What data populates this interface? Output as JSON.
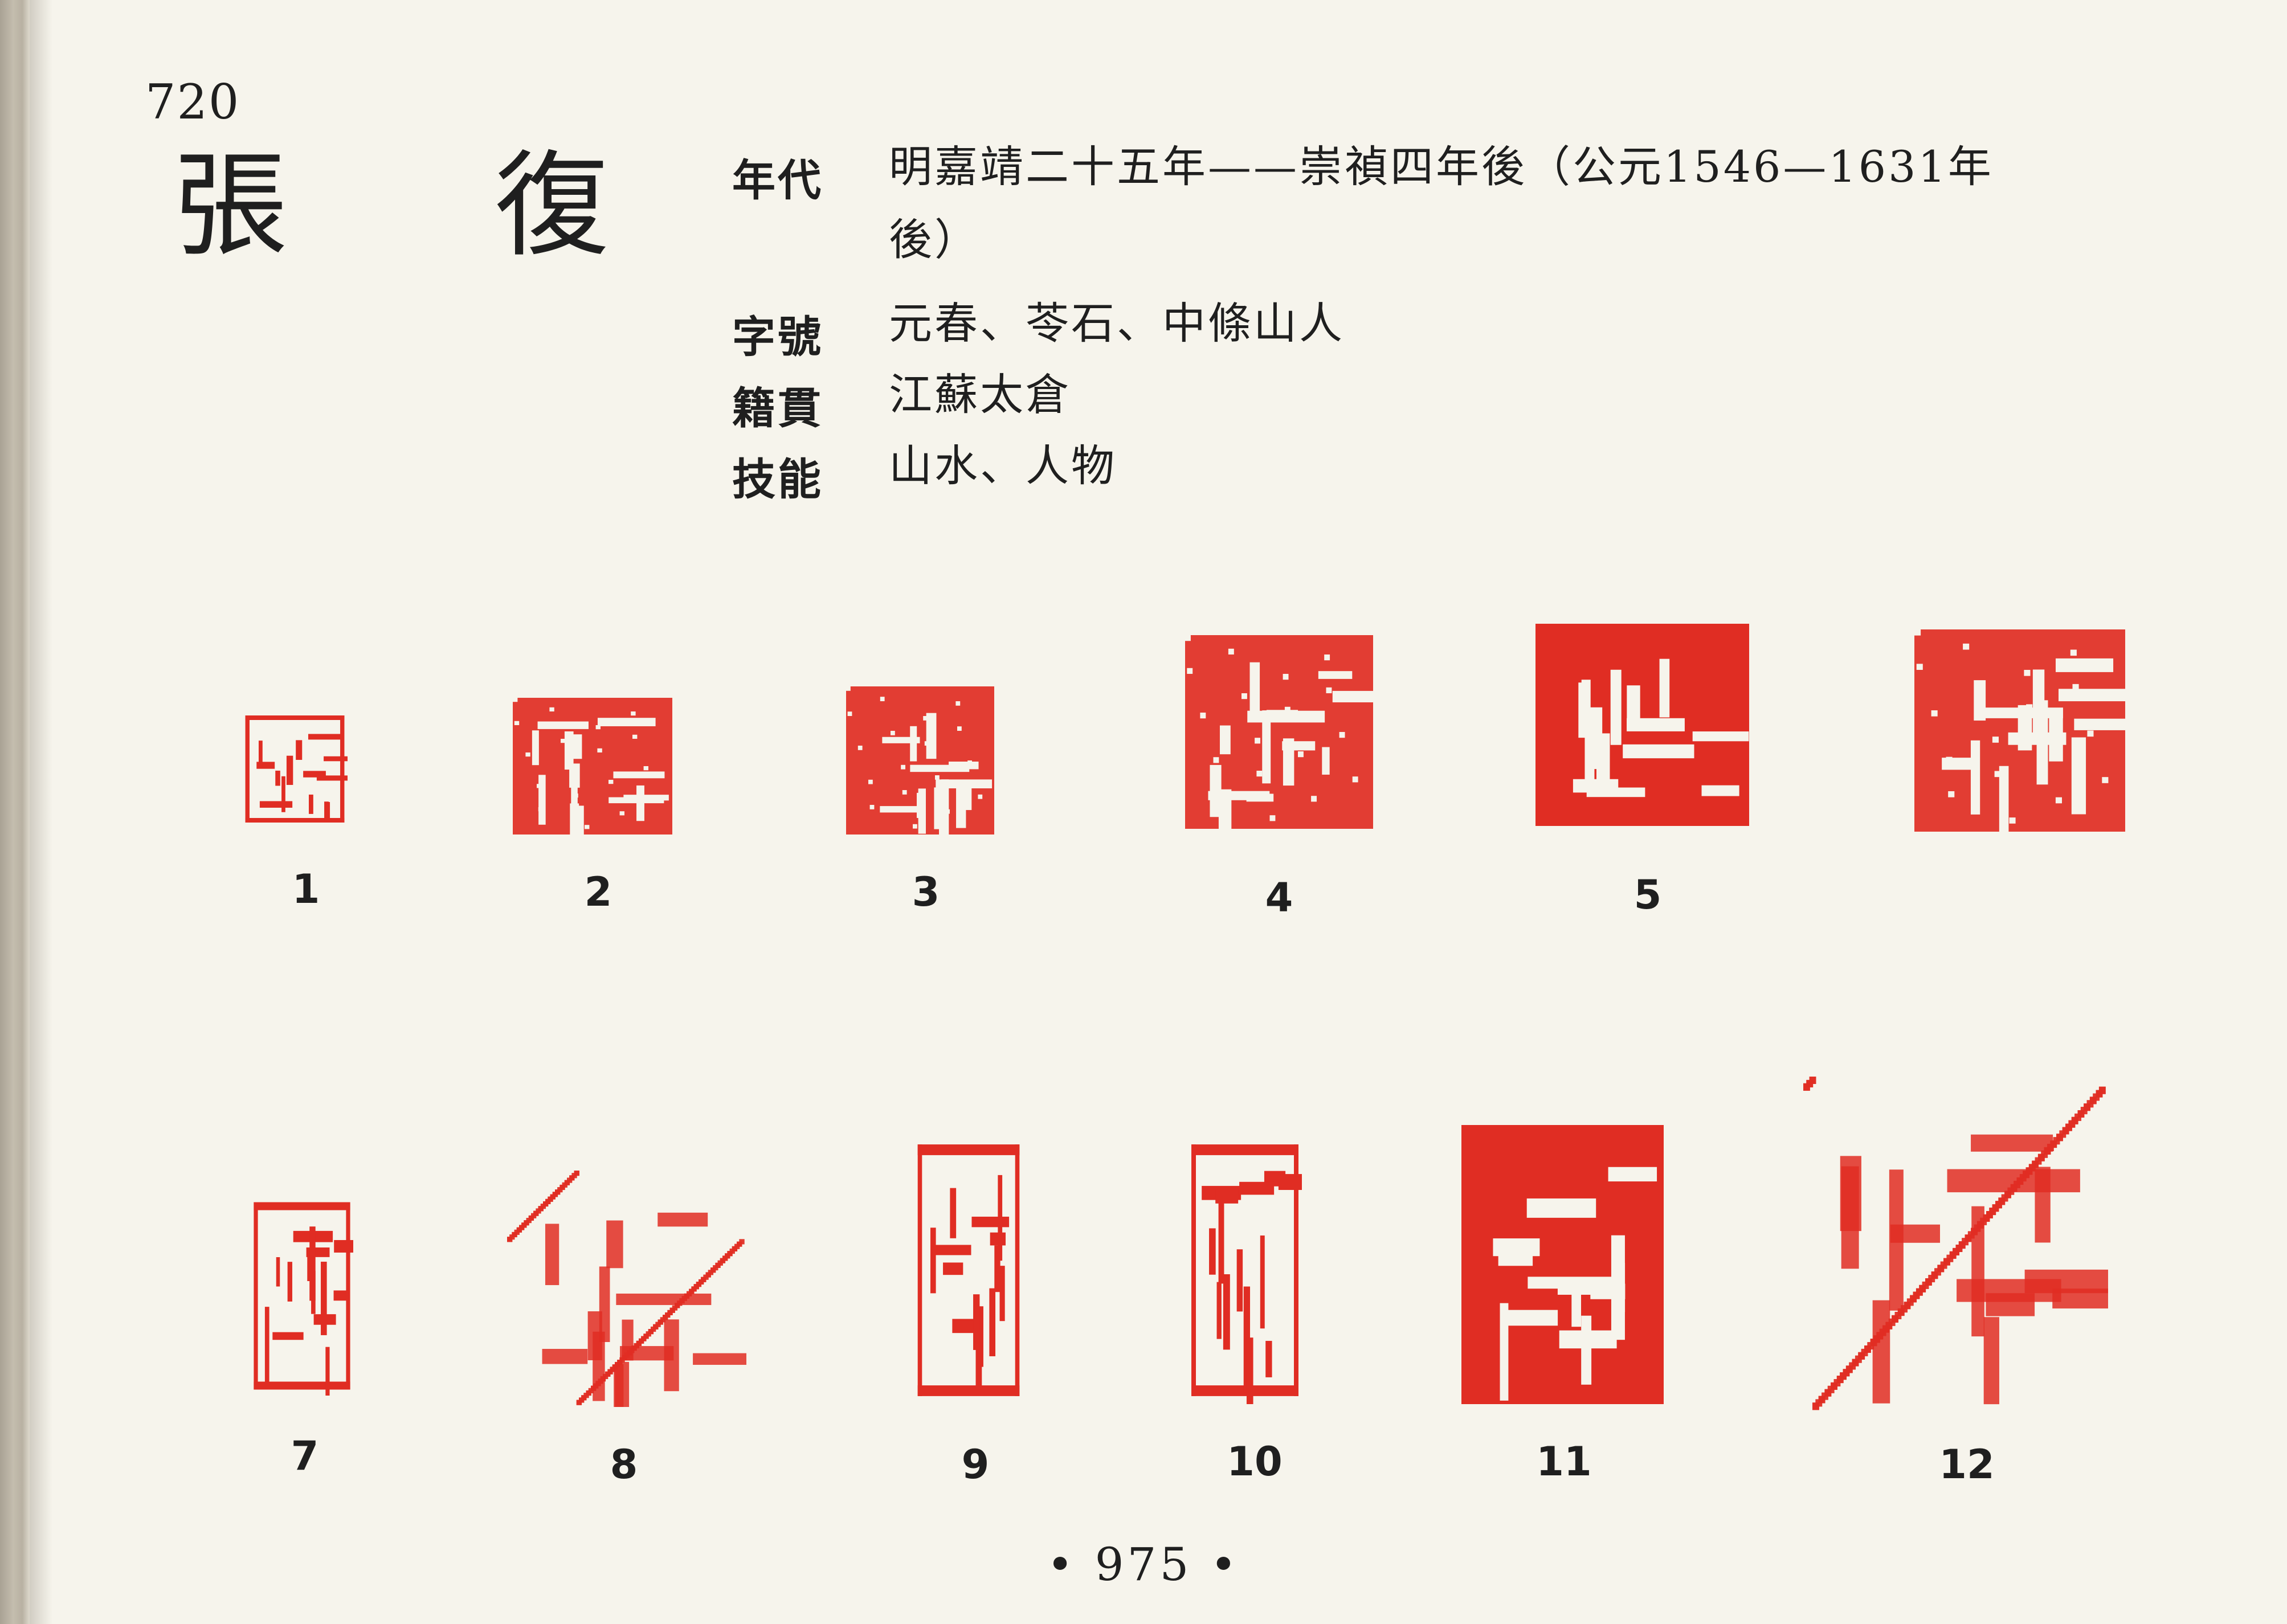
{
  "book_page_label": "720",
  "artist": {
    "name": "張 復"
  },
  "info": [
    {
      "label": "年代",
      "value": "明嘉靖二十五年——崇禎四年後（公元1546—1631年後）"
    },
    {
      "label": "字號",
      "value": "元春、苓石、中條山人"
    },
    {
      "label": "籍貫",
      "value": "江蘇太倉"
    },
    {
      "label": "技能",
      "value": "山水、人物"
    }
  ],
  "seals": [
    {
      "number": "1",
      "style": "outline"
    },
    {
      "number": "2",
      "style": "intaglio"
    },
    {
      "number": "3",
      "style": "intaglio"
    },
    {
      "number": "4",
      "style": "intaglio"
    },
    {
      "number": "5",
      "style": "solid"
    },
    {
      "number": "",
      "style": "intaglio"
    },
    {
      "number": "7",
      "style": "outline"
    },
    {
      "number": "8",
      "style": "faded"
    },
    {
      "number": "9",
      "style": "outline"
    },
    {
      "number": "10",
      "style": "outline"
    },
    {
      "number": "11",
      "style": "solid"
    },
    {
      "number": "12",
      "style": "faded"
    }
  ],
  "colors": {
    "seal_red": "#e02d23",
    "paper": "#f6f4ec",
    "text": "#1f1f1f"
  },
  "footer": {
    "page_number": "• 975 •"
  }
}
